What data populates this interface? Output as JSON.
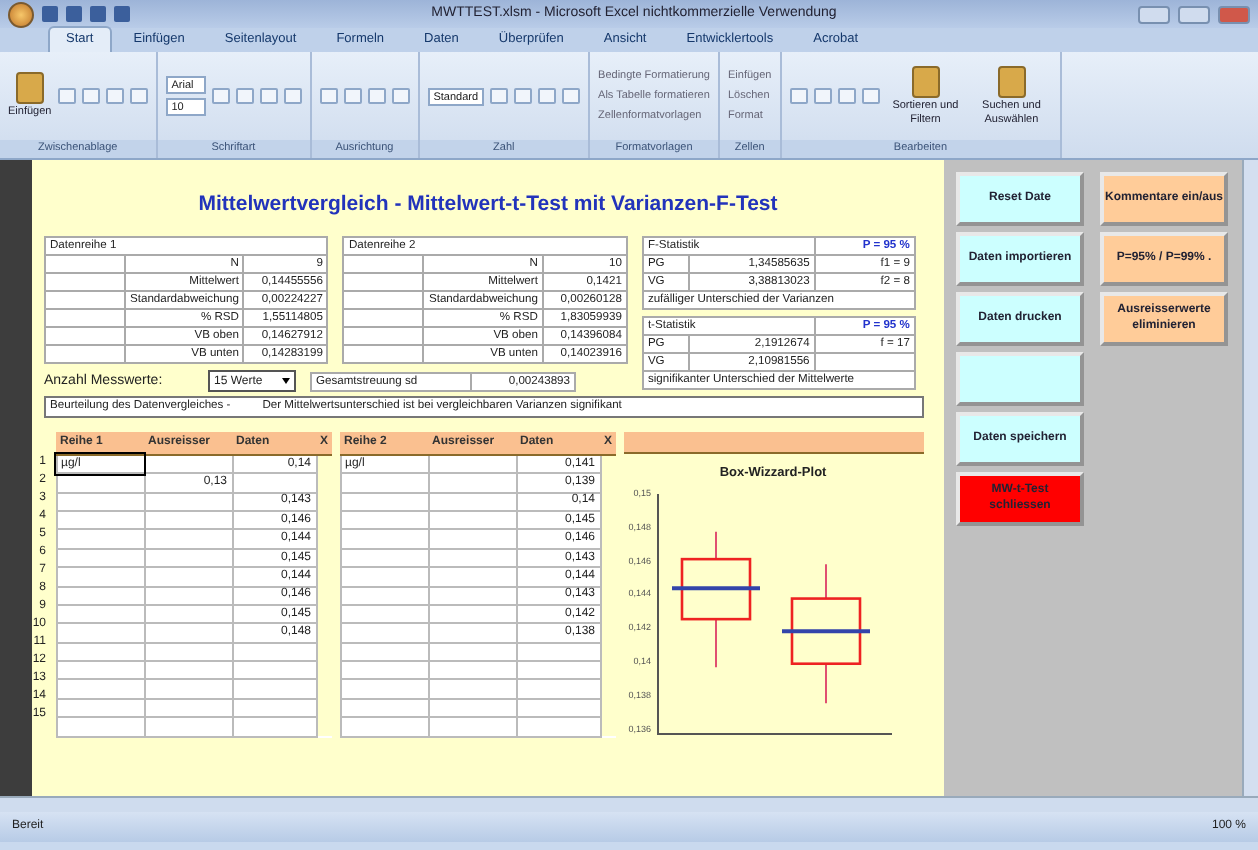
{
  "window": {
    "title": "MWTTEST.xlsm - Microsoft Excel nichtkommerzielle Verwendung"
  },
  "tabs": [
    {
      "label": "Start",
      "selected": true
    },
    {
      "label": "Einfügen",
      "selected": false
    },
    {
      "label": "Seitenlayout",
      "selected": false
    },
    {
      "label": "Formeln",
      "selected": false
    },
    {
      "label": "Daten",
      "selected": false
    },
    {
      "label": "Überprüfen",
      "selected": false
    },
    {
      "label": "Ansicht",
      "selected": false
    },
    {
      "label": "Entwicklertools",
      "selected": false
    },
    {
      "label": "Acrobat",
      "selected": false
    }
  ],
  "ribbon_groups": [
    {
      "label": "Zwischenablage",
      "controls": [
        {
          "kind": "big",
          "label": "Einfügen"
        },
        {
          "kind": "icons"
        }
      ]
    },
    {
      "label": "Schriftart",
      "controls": [
        {
          "kind": "fields",
          "values": [
            "Arial",
            "10"
          ]
        },
        {
          "kind": "icons"
        }
      ]
    },
    {
      "label": "Ausrichtung",
      "controls": [
        {
          "kind": "icons"
        }
      ]
    },
    {
      "label": "Zahl",
      "controls": [
        {
          "kind": "fields",
          "values": [
            "Standard"
          ]
        },
        {
          "kind": "icons"
        }
      ]
    },
    {
      "label": "Formatvorlagen",
      "controls": [
        {
          "kind": "smalls",
          "labels": [
            "Bedingte Formatierung",
            "Als Tabelle formatieren",
            "Zellenformatvorlagen"
          ]
        }
      ]
    },
    {
      "label": "Zellen",
      "controls": [
        {
          "kind": "smalls",
          "labels": [
            "Einfügen",
            "Löschen",
            "Format"
          ]
        }
      ]
    },
    {
      "label": "Bearbeiten",
      "controls": [
        {
          "kind": "icons"
        },
        {
          "kind": "big",
          "label": "Sortieren und Filtern"
        },
        {
          "kind": "big",
          "label": "Suchen und Auswählen"
        }
      ]
    }
  ],
  "sheet": {
    "title": "Mittelwertvergleich - Mittelwert-t-Test mit Varianzen-F-Test",
    "series_stats": [
      {
        "header": "Datenreihe 1",
        "rows": [
          [
            "N",
            "9"
          ],
          [
            "Mittelwert",
            "0,14455556"
          ],
          [
            "Standardabweichung",
            "0,00224227"
          ],
          [
            "% RSD",
            "1,55114805"
          ],
          [
            "VB oben",
            "0,14627912"
          ],
          [
            "VB unten",
            "0,14283199"
          ]
        ]
      },
      {
        "header": "Datenreihe 2",
        "rows": [
          [
            "N",
            "10"
          ],
          [
            "Mittelwert",
            "0,1421"
          ],
          [
            "Standardabweichung",
            "0,00260128"
          ],
          [
            "% RSD",
            "1,83059939"
          ],
          [
            "VB oben",
            "0,14396084"
          ],
          [
            "VB unten",
            "0,14023916"
          ]
        ]
      }
    ],
    "tests": [
      {
        "header": "F-Statistik",
        "level": "P = 95 %",
        "rows": [
          [
            "PG",
            "1,34585635",
            "f1 = 9"
          ],
          [
            "VG",
            "3,38813023",
            "f2 = 8"
          ]
        ],
        "verdict": "zufälliger Unterschied der Varianzen"
      },
      {
        "header": "t-Statistik",
        "level": "P = 95 %",
        "rows": [
          [
            "PG",
            "2,1912674",
            "f = 17"
          ],
          [
            "VG",
            "2,10981556"
          ]
        ],
        "verdict": "signifikanter Unterschied der Mittelwerte"
      }
    ],
    "count": {
      "label": "Anzahl Messwerte:",
      "value": "15 Werte"
    },
    "spread": {
      "label": "Gesamtstreuung sd",
      "value": "0,00243893"
    },
    "assessment": {
      "label": "Beurteilung des Datenvergleiches -",
      "text": "Der Mittelwertsunterschied ist bei vergleichbaren Varianzen signifikant"
    },
    "row_numbers": [
      "1",
      "2",
      "3",
      "4",
      "5",
      "6",
      "7",
      "8",
      "9",
      "10",
      "11",
      "12",
      "13",
      "14",
      "15"
    ],
    "data_tables": [
      {
        "columns": [
          "Reihe 1",
          "Ausreisser",
          "Daten",
          "X"
        ],
        "rows": [
          {
            "unit": "µg/l",
            "value": "0,14",
            "selected": true
          },
          {
            "outlier": "0,13",
            "selected": false
          },
          {
            "value": "0,143",
            "selected": false
          },
          {
            "value": "0,146",
            "selected": false
          },
          {
            "value": "0,144",
            "selected": false
          },
          {
            "value": "0,145",
            "selected": false
          },
          {
            "value": "0,144",
            "selected": false
          },
          {
            "value": "0,146",
            "selected": false
          },
          {
            "value": "0,145",
            "selected": false
          },
          {
            "value": "0,148",
            "selected": false
          },
          {
            "selected": false
          },
          {
            "selected": false
          },
          {
            "selected": false
          },
          {
            "selected": false
          },
          {
            "selected": false
          }
        ]
      },
      {
        "columns": [
          "Reihe 2",
          "Ausreisser",
          "Daten",
          "X"
        ],
        "rows": [
          {
            "unit": "µg/l",
            "value": "0,141",
            "selected": false
          },
          {
            "value": "0,139",
            "selected": false
          },
          {
            "value": "0,14",
            "selected": false
          },
          {
            "value": "0,145",
            "selected": false
          },
          {
            "value": "0,146",
            "selected": false
          },
          {
            "value": "0,143",
            "selected": false
          },
          {
            "value": "0,144",
            "selected": false
          },
          {
            "value": "0,143",
            "selected": false
          },
          {
            "value": "0,142",
            "selected": false
          },
          {
            "value": "0,138",
            "selected": false
          },
          {
            "selected": false
          },
          {
            "selected": false
          },
          {
            "selected": false
          },
          {
            "selected": false
          },
          {
            "selected": false
          }
        ]
      }
    ],
    "chart": {
      "title": "Box-Wizzard-Plot",
      "ytick_labels": [
        "0,15",
        "0,148",
        "0,146",
        "0,144",
        "0,142",
        "0,14",
        "0,138",
        "0,136"
      ]
    }
  },
  "macro_buttons": [
    [
      {
        "label": "Reset Date",
        "color": "#ccffff"
      },
      {
        "label": "Daten importieren",
        "color": "#ccffff"
      },
      {
        "label": "Daten drucken",
        "color": "#ccffff"
      },
      {
        "color": "#ccffff"
      },
      {
        "label": "Daten speichern",
        "color": "#ccffff"
      },
      {
        "label": "MW-t-Test schliessen",
        "color": "#ff0000"
      }
    ],
    [
      {
        "label": "Kommentare ein/aus",
        "color": "#ffcc99"
      },
      {
        "label": "P=95% / P=99% .",
        "color": "#ffcc99"
      },
      {
        "label": "Ausreisserwerte eliminieren",
        "color": "#ffcc99"
      }
    ]
  ],
  "status_bar": {
    "mode": "Bereit",
    "zoom": "100 %"
  }
}
